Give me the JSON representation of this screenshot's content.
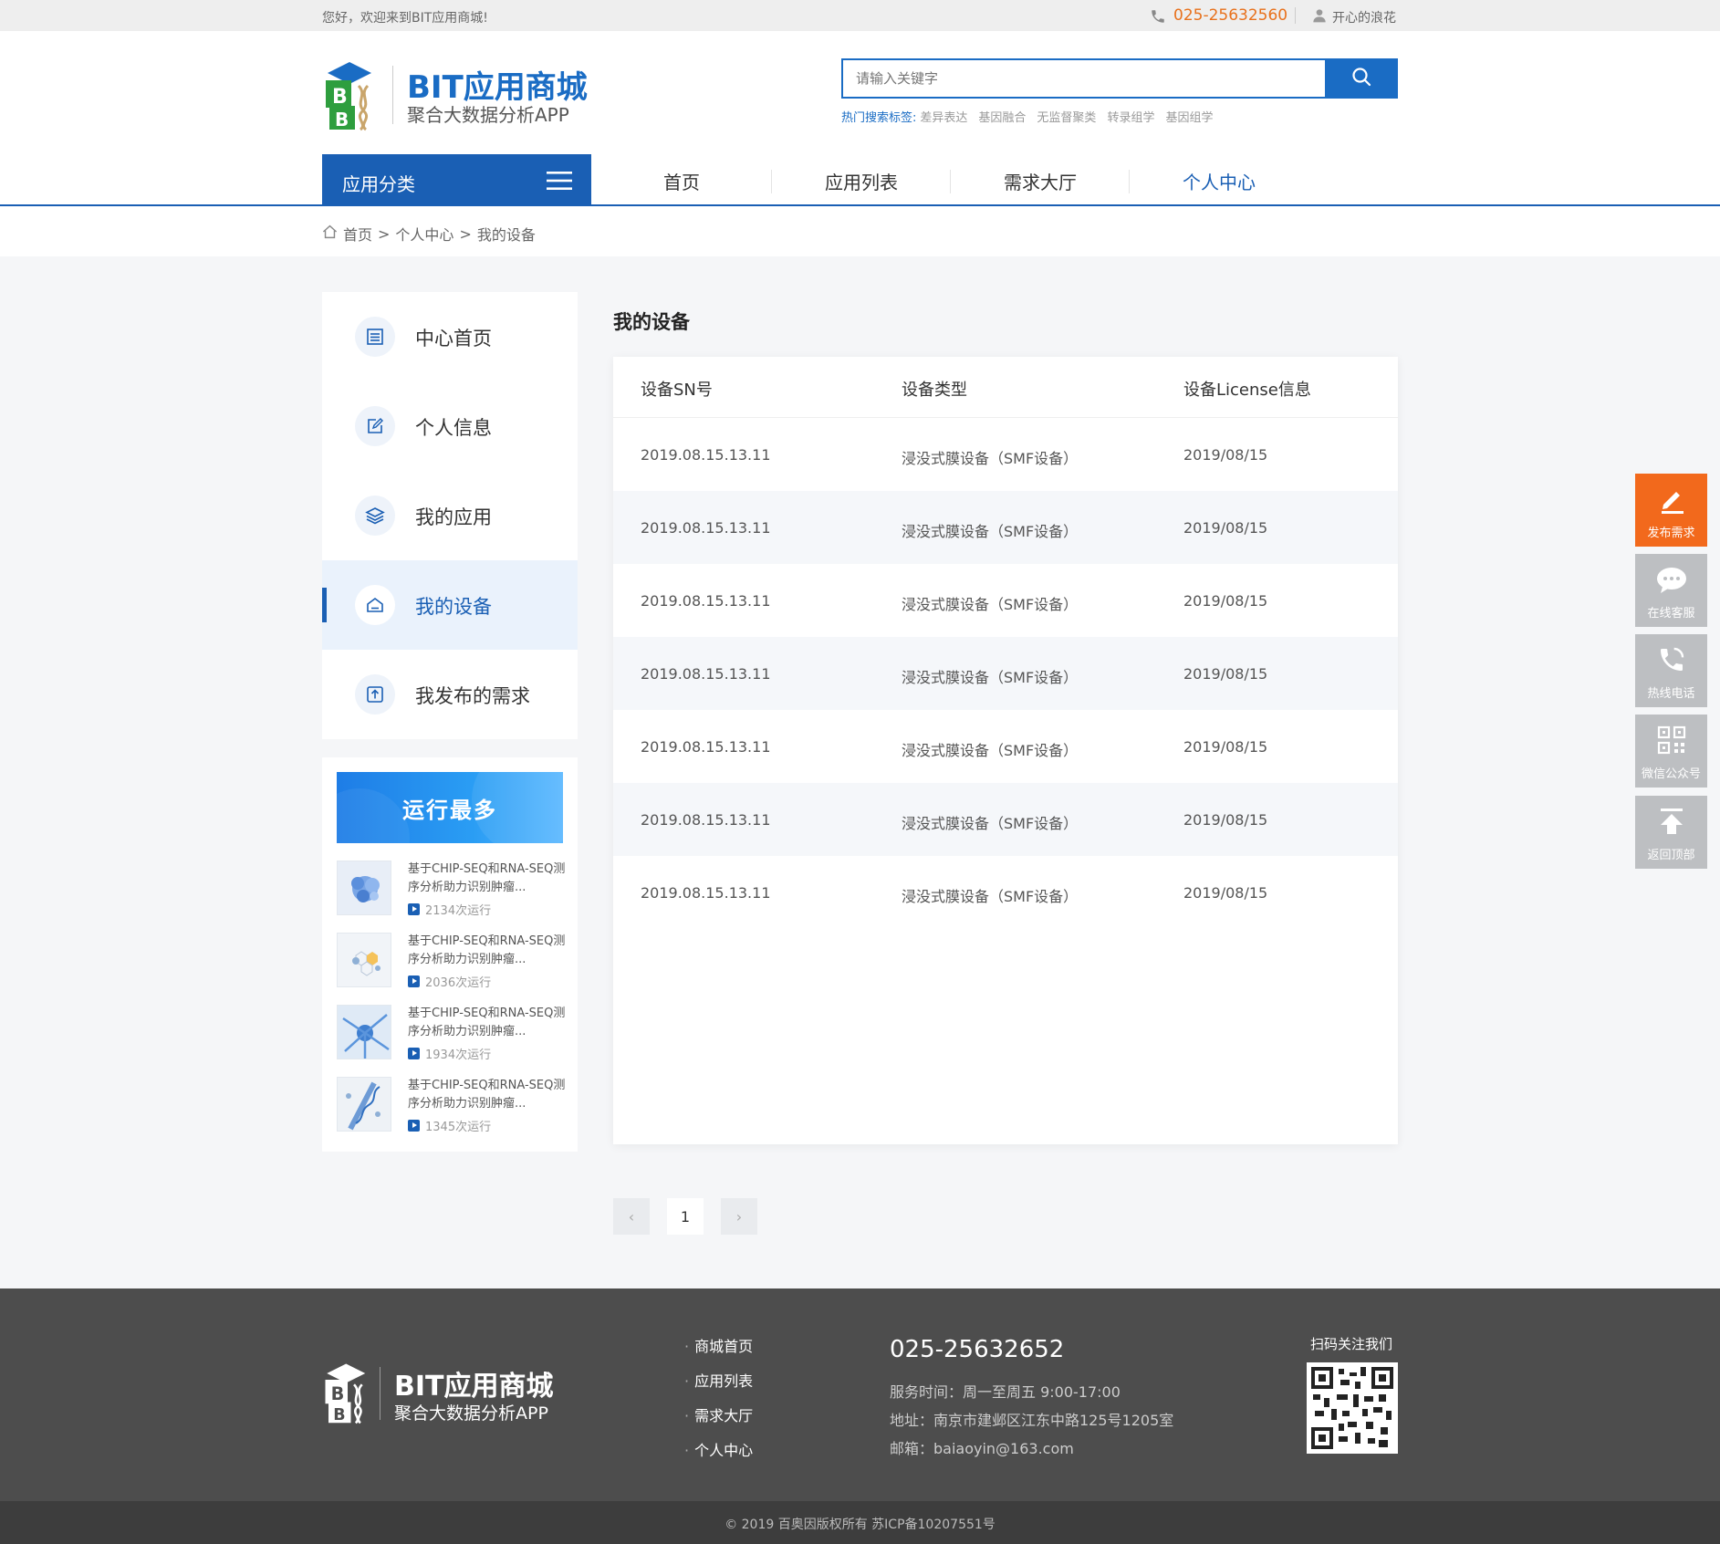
{
  "topbar": {
    "welcome": "您好，欢迎来到BIT应用商城!",
    "phone": "025-25632560",
    "username": "开心的浪花"
  },
  "header": {
    "logo_title": "BIT应用商城",
    "logo_subtitle": "聚合大数据分析APP",
    "search_placeholder": "请输入关键字",
    "hot_label": "热门搜索标签:",
    "hot_tags": [
      "差异表达",
      "基因融合",
      "无监督聚类",
      "转录组学",
      "基因组学"
    ]
  },
  "nav": {
    "category_label": "应用分类",
    "items": [
      "首页",
      "应用列表",
      "需求大厅",
      "个人中心"
    ],
    "active_index": 3
  },
  "breadcrumb": [
    "首页",
    "个人中心",
    "我的设备"
  ],
  "sidebar": {
    "items": [
      {
        "label": "中心首页",
        "icon": "list-icon"
      },
      {
        "label": "个人信息",
        "icon": "edit-icon"
      },
      {
        "label": "我的应用",
        "icon": "layers-icon"
      },
      {
        "label": "我的设备",
        "icon": "device-icon"
      },
      {
        "label": "我发布的需求",
        "icon": "upload-icon"
      }
    ],
    "active_index": 3
  },
  "hot_panel": {
    "banner_title": "运行最多",
    "apps": [
      {
        "name": "基于CHIP-SEQ和RNA-SEQ测序分析助力识别肿瘤...",
        "runs": "2134次运行"
      },
      {
        "name": "基于CHIP-SEQ和RNA-SEQ测序分析助力识别肿瘤...",
        "runs": "2036次运行"
      },
      {
        "name": "基于CHIP-SEQ和RNA-SEQ测序分析助力识别肿瘤...",
        "runs": "1934次运行"
      },
      {
        "name": "基于CHIP-SEQ和RNA-SEQ测序分析助力识别肿瘤...",
        "runs": "1345次运行"
      }
    ]
  },
  "main": {
    "title": "我的设备",
    "columns": [
      "设备SN号",
      "设备类型",
      "设备License信息"
    ],
    "rows": [
      [
        "2019.08.15.13.11",
        "浸没式膜设备（SMF设备）",
        "2019/08/15"
      ],
      [
        "2019.08.15.13.11",
        "浸没式膜设备（SMF设备）",
        "2019/08/15"
      ],
      [
        "2019.08.15.13.11",
        "浸没式膜设备（SMF设备）",
        "2019/08/15"
      ],
      [
        "2019.08.15.13.11",
        "浸没式膜设备（SMF设备）",
        "2019/08/15"
      ],
      [
        "2019.08.15.13.11",
        "浸没式膜设备（SMF设备）",
        "2019/08/15"
      ],
      [
        "2019.08.15.13.11",
        "浸没式膜设备（SMF设备）",
        "2019/08/15"
      ],
      [
        "2019.08.15.13.11",
        "浸没式膜设备（SMF设备）",
        "2019/08/15"
      ]
    ],
    "pager": {
      "prev": "‹",
      "current": "1",
      "next": "›"
    }
  },
  "float_tools": [
    "发布需求",
    "在线客服",
    "热线电话",
    "微信公众号",
    "返回顶部"
  ],
  "footer": {
    "logo_title": "BIT应用商城",
    "logo_subtitle": "聚合大数据分析APP",
    "links": [
      "商城首页",
      "应用列表",
      "需求大厅",
      "个人中心"
    ],
    "phone": "025-25632652",
    "service_time": "服务时间：周一至周五 9:00-17:00",
    "address": "地址：南京市建邺区江东中路125号1205室",
    "email": "邮箱：baiaoyin@163.com",
    "qr_title": "扫码关注我们",
    "copyright": "© 2019 百奥因版权所有    苏ICP备10207551号"
  },
  "colors": {
    "primary": "#1a5fb4",
    "accent_orange": "#f2691c",
    "footer_bg": "#4d4d4d"
  }
}
